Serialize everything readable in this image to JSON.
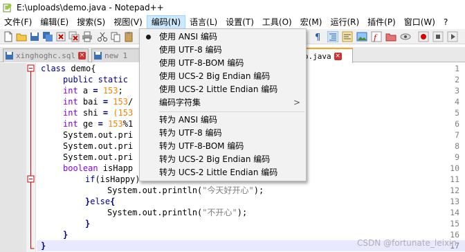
{
  "window": {
    "title": "E:\\uploads\\demo.java - Notepad++"
  },
  "menubar": [
    "文件(F)",
    "编辑(E)",
    "搜索(S)",
    "视图(V)",
    "编码(N)",
    "语言(L)",
    "设置(T)",
    "工具(O)",
    "宏(M)",
    "运行(R)",
    "插件(P)",
    "窗口(W)",
    "?"
  ],
  "tabs": [
    {
      "label": "xinghoghc.sql"
    },
    {
      "label": "new 1"
    },
    {
      "label": "demo.java"
    }
  ],
  "encoding_menu": {
    "items": [
      {
        "label": "使用 ANSI 编码",
        "checked": true
      },
      {
        "label": "使用 UTF-8 编码"
      },
      {
        "label": "使用 UTF-8-BOM 编码"
      },
      {
        "label": "使用 UCS-2 Big Endian 编码"
      },
      {
        "label": "使用 UCS-2 Little Endian 编码"
      },
      {
        "label": "编码字符集",
        "submenu": true
      },
      {
        "label": "转为 ANSI 编码"
      },
      {
        "label": "转为 UTF-8 编码"
      },
      {
        "label": "转为 UTF-8-BOM 编码"
      },
      {
        "label": "转为 UCS-2 Big Endian 编码"
      },
      {
        "label": "转为 UCS-2 Little Endian 编码"
      }
    ],
    "submenu_arrow": ">"
  },
  "editor": {
    "line_numbers": [
      "1",
      "2",
      "3",
      "4",
      "5",
      "6",
      "7",
      "8",
      "9",
      "10",
      "11",
      "12",
      "13",
      "14",
      "15",
      "16",
      "17"
    ],
    "lines": {
      "l1_kw": "class",
      "l1_rest": " demo{",
      "l2_kw": "public static",
      "l2_rest": "",
      "l3_kw": "int",
      "l3_a": " a ",
      "l3_eq": "=",
      "l3_num": " 153",
      "l3_end": ";",
      "l4_kw": "int",
      "l4_a": " bai ",
      "l4_eq": "=",
      "l4_num": " 153",
      "l4_end": "/",
      "l5_kw": "int",
      "l5_a": " shi ",
      "l5_eq": "=",
      "l5_rest": " (153",
      "l6_kw": "int",
      "l6_a": " ge ",
      "l6_eq": "=",
      "l6_num": " 153",
      "l6_end": "%1",
      "l7": "System.out.pri",
      "l8": "System.out.pri",
      "l9": "System.out.pri",
      "l10_kw": "boolean",
      "l10_rest": " isHapp",
      "l11_kw": "if",
      "l11_rest": "(isHappy)",
      "l12_pre": "System.out.println(",
      "l12_str": "\"今天好开心\"",
      "l12_post": ");",
      "l13_a": "}",
      "l13_kw": "else",
      "l13_b": "{",
      "l14_pre": "System.out.println(",
      "l14_str": "\"不开心\"",
      "l14_post": ");",
      "l15": "}",
      "l16": "}",
      "l17": "}"
    }
  },
  "watermark": "CSDN @fortunate_leixin",
  "colors": {
    "menu_highlight": "#cce8ff",
    "active_tab_accent": "#f5a623",
    "keyword": "#00008b",
    "number": "#ff8000"
  }
}
